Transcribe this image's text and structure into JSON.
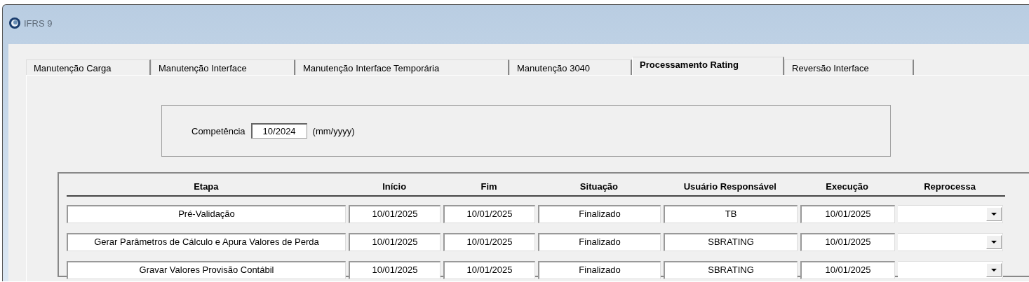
{
  "window": {
    "title": "IFRS 9"
  },
  "tabs": [
    {
      "label": "Manutenção Carga",
      "selected": false
    },
    {
      "label": "Manutenção Interface",
      "selected": false
    },
    {
      "label": "Manutenção Interface Temporária",
      "selected": false
    },
    {
      "label": "Manutenção 3040",
      "selected": false
    },
    {
      "label": "Processamento Rating",
      "selected": true
    },
    {
      "label": "Reversão Interface",
      "selected": false
    }
  ],
  "competencia": {
    "label": "Competência",
    "value": "10/2024",
    "hint": "(mm/yyyy)"
  },
  "table": {
    "columns": [
      "Etapa",
      "Início",
      "Fim",
      "Situação",
      "Usuário Responsável",
      "Execução",
      "Reprocessa"
    ],
    "rows": [
      {
        "etapa": "Pré-Validação",
        "inicio": "10/01/2025",
        "fim": "10/01/2025",
        "situacao": "Finalizado",
        "usuario": "TB",
        "execucao": "10/01/2025"
      },
      {
        "etapa": "Gerar Parâmetros de Cálculo e Apura Valores de Perda",
        "inicio": "10/01/2025",
        "fim": "10/01/2025",
        "situacao": "Finalizado",
        "usuario": "SBRATING",
        "execucao": "10/01/2025"
      },
      {
        "etapa": "Gravar Valores Provisão Contábil",
        "inicio": "10/01/2025",
        "fim": "10/01/2025",
        "situacao": "Finalizado",
        "usuario": "SBRATING",
        "execucao": "10/01/2025"
      }
    ]
  }
}
